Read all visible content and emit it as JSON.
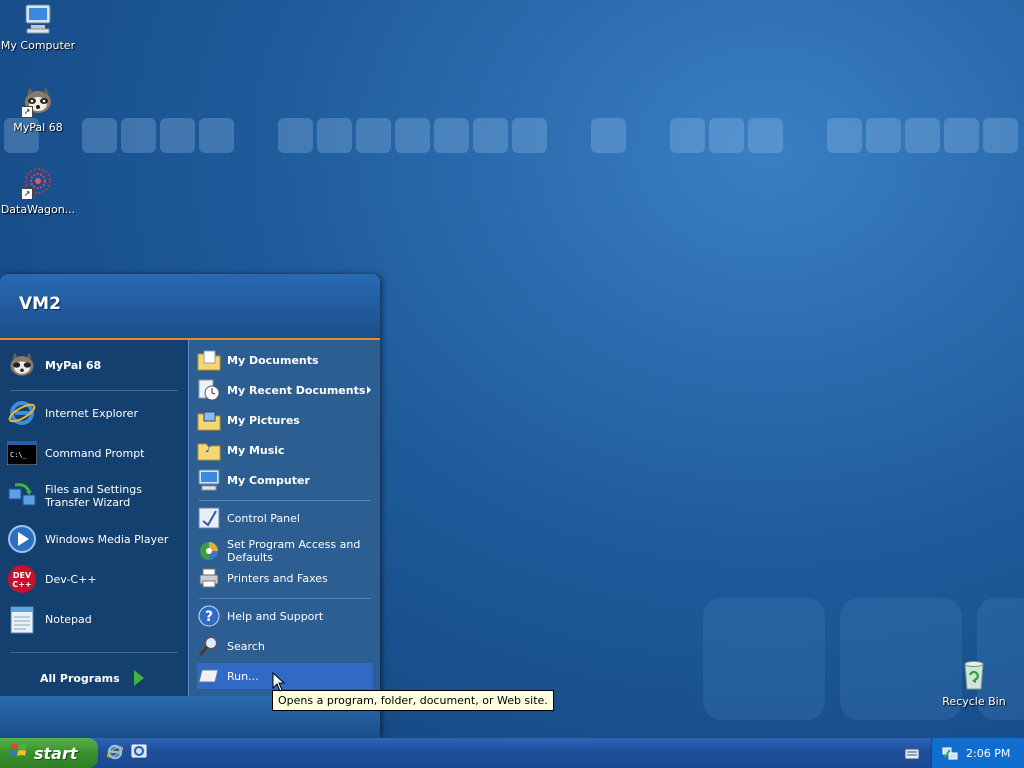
{
  "desktop": {
    "icons": [
      {
        "label": "My Computer",
        "icon": "my-computer-icon"
      },
      {
        "label": "MyPal 68",
        "icon": "mypal-icon"
      },
      {
        "label": "DataWagon...",
        "icon": "datawagon-icon"
      },
      {
        "label": "Recycle Bin",
        "icon": "recycle-bin-icon"
      }
    ]
  },
  "start_menu": {
    "user_name": "VM2",
    "left_items": [
      {
        "label": "MyPal 68",
        "icon": "mypal-icon",
        "pinned": true
      },
      {
        "label": "Internet Explorer",
        "icon": "internet-explorer-icon"
      },
      {
        "label": "Command Prompt",
        "icon": "command-prompt-icon"
      },
      {
        "label": "Files and Settings Transfer Wizard",
        "icon": "transfer-wizard-icon"
      },
      {
        "label": "Windows Media Player",
        "icon": "media-player-icon"
      },
      {
        "label": "Dev-C++",
        "icon": "devcpp-icon"
      },
      {
        "label": "Notepad",
        "icon": "notepad-icon"
      }
    ],
    "all_programs_label": "All Programs",
    "right_items": [
      {
        "label": "My Documents",
        "icon": "folder-documents-icon"
      },
      {
        "label": "My Recent Documents",
        "icon": "recent-documents-icon"
      },
      {
        "label": "My Pictures",
        "icon": "folder-pictures-icon"
      },
      {
        "label": "My Music",
        "icon": "folder-music-icon"
      },
      {
        "label": "My Computer",
        "icon": "my-computer-icon"
      },
      {
        "label": "Control Panel",
        "icon": "control-panel-icon"
      },
      {
        "label": "Set Program Access and Defaults",
        "icon": "program-access-icon"
      },
      {
        "label": "Printers and Faxes",
        "icon": "printer-icon"
      },
      {
        "label": "Help and Support",
        "icon": "help-icon"
      },
      {
        "label": "Search",
        "icon": "search-icon"
      },
      {
        "label": "Run...",
        "icon": "run-icon"
      }
    ]
  },
  "tooltip": "Opens a program, folder, document, or Web site.",
  "taskbar": {
    "start_label": "start",
    "quick_launch": [
      "internet-explorer-icon",
      "show-desktop-icon"
    ],
    "clock": "2:06 PM"
  },
  "colors": {
    "taskbar_blue": "#1f4f9c",
    "start_green": "#3a8f2e",
    "menu_accent": "#e48b2a",
    "highlight": "#316ac5"
  }
}
